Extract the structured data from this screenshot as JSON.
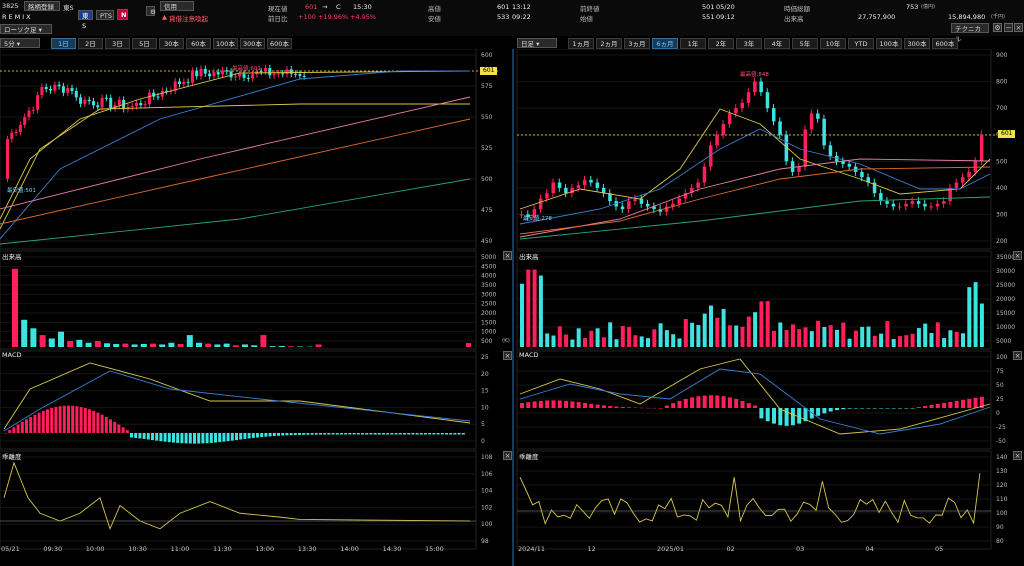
{
  "header": {
    "code": "3825",
    "register_label": "銘柄登録",
    "market_label": "東S",
    "pts_label": "PTS",
    "n_label": "N",
    "credit_label": "信用",
    "name": "REMIX",
    "chart_type_select": "ローソク足",
    "warning_label": "貸借注意喚起",
    "fields": [
      {
        "label": "現在値",
        "value": "601",
        "extra": "C",
        "time": "15:30"
      },
      {
        "label": "前日比",
        "value": "+100",
        "pct": "+19.96%",
        "extra2": "+4.95%"
      },
      {
        "label": "高値",
        "value": "601",
        "time": "13:12"
      },
      {
        "label": "安値",
        "value": "533",
        "time": "09:22"
      },
      {
        "label": "前終値",
        "value": "501",
        "time": "05/20"
      },
      {
        "label": "始値",
        "value": "551",
        "time": "09:12"
      },
      {
        "label": "時価総額",
        "value": "753",
        "unit": "(億円)"
      },
      {
        "label": "出来高",
        "value": "27,757,900",
        "extra": "15,894,980",
        "unit": "(千円)"
      }
    ],
    "technical_label": "テクニカル"
  },
  "left": {
    "interval_select": "5分",
    "tabs": [
      "1日",
      "2日",
      "3日",
      "5日",
      "30本",
      "60本",
      "100本",
      "300本",
      "600本"
    ],
    "selected_tab": 0,
    "price_axis": [
      "600",
      "575",
      "550",
      "525",
      "500",
      "475",
      "450"
    ],
    "price_tag": "601",
    "high_note": "最高値:601",
    "low_note": "最安値:501",
    "volume_title": "出来高",
    "volume_axis": [
      "5000",
      "4500",
      "4000",
      "3500",
      "3000",
      "2500",
      "2000",
      "1500",
      "1000",
      "500"
    ],
    "volume_unit": "(K)",
    "macd_title": "MACD",
    "macd_axis": [
      "25",
      "20",
      "15",
      "10",
      "5",
      "0"
    ],
    "dev_title": "乖離度",
    "dev_axis": [
      "108",
      "106",
      "104",
      "102",
      "100",
      "98"
    ],
    "x_labels": [
      "05/21",
      "09:30",
      "10:00",
      "10:30",
      "11:00",
      "11:30",
      "13:00",
      "13:30",
      "14:00",
      "14:30",
      "15:00"
    ]
  },
  "right": {
    "interval_select": "日足",
    "tabs": [
      "1ヵ月",
      "2ヵ月",
      "3ヵ月",
      "6ヵ月",
      "1年",
      "2年",
      "3年",
      "4年",
      "5年",
      "10年",
      "YTD",
      "100本",
      "300本",
      "600本"
    ],
    "selected_tab": 3,
    "price_axis": [
      "900",
      "800",
      "700",
      "600",
      "500",
      "400",
      "300",
      "200"
    ],
    "price_tag": "601",
    "high_note": "最高値:848",
    "low_note": "最安値:278",
    "volume_title": "出来高",
    "volume_axis": [
      "35000",
      "30000",
      "25000",
      "20000",
      "15000",
      "10000",
      "5000"
    ],
    "macd_title": "MACD",
    "macd_axis": [
      "100",
      "75",
      "50",
      "25",
      "0",
      "-25",
      "-50"
    ],
    "dev_title": "乖離度",
    "dev_axis": [
      "140",
      "130",
      "120",
      "110",
      "100",
      "90",
      "80"
    ],
    "x_labels": [
      "2024/11",
      "12",
      "2025/01",
      "02",
      "03",
      "04",
      "05"
    ]
  },
  "colors": {
    "up": "#ff1f5a",
    "down": "#3de3e0",
    "ma_yellow": "#d9c84a",
    "ma_blue": "#3a7fd0",
    "ma_pink": "#e77fa8",
    "ma_orange": "#e06a2a",
    "ma_green": "#2aa37a"
  }
}
